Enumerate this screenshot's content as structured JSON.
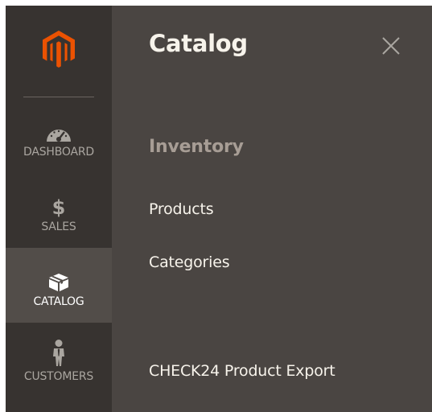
{
  "sidebar": {
    "logo_name": "magento-logo",
    "items": [
      {
        "label": "DASHBOARD",
        "icon": "dashboard-gauge-icon",
        "active": false
      },
      {
        "label": "SALES",
        "icon": "dollar-icon",
        "glyph": "$",
        "active": false
      },
      {
        "label": "CATALOG",
        "icon": "box-icon",
        "active": true
      },
      {
        "label": "CUSTOMERS",
        "icon": "person-icon",
        "active": false
      }
    ]
  },
  "panel": {
    "title": "Catalog",
    "close_icon": "close-icon",
    "section_title": "Inventory",
    "links": [
      {
        "label": "Products"
      },
      {
        "label": "Categories"
      },
      {
        "label": "CHECK24 Product Export"
      }
    ]
  },
  "colors": {
    "sidebar_bg": "#373330",
    "sidebar_active_bg": "#524d49",
    "panel_bg": "#4a4542",
    "logo_orange": "#eb5202",
    "section_title": "#a79d95",
    "text_light": "#f7f3eb",
    "nav_label": "#aaa6a0"
  }
}
